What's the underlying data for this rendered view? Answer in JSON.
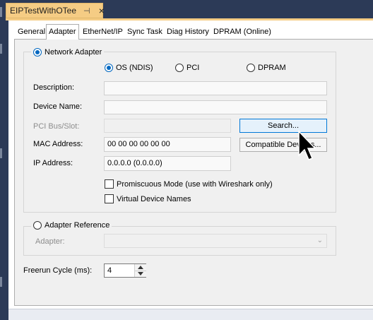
{
  "document_tab": {
    "title": "EIPTestWithOTee",
    "pin": "⊣",
    "close": "×"
  },
  "tabs": [
    "General",
    "Adapter",
    "EtherNet/IP",
    "Sync Task",
    "Diag History",
    "DPRAM (Online)"
  ],
  "active_tab": "Adapter",
  "network_adapter": {
    "radio_label": "Network Adapter",
    "selected": true,
    "mode_options": [
      "OS (NDIS)",
      "PCI",
      "DPRAM"
    ],
    "selected_mode": "OS (NDIS)",
    "description_label": "Description:",
    "description_value": "",
    "device_name_label": "Device Name:",
    "device_name_value": "",
    "pci_label": "PCI Bus/Slot:",
    "pci_value": "",
    "search_button": "Search...",
    "mac_label": "MAC Address:",
    "mac_value": "00 00 00 00 00 00",
    "compatible_button": "Compatible Devices...",
    "ip_label": "IP Address:",
    "ip_value": "0.0.0.0 (0.0.0.0)",
    "promiscuous_label": "Promiscuous Mode (use with Wireshark only)",
    "promiscuous_checked": false,
    "virtual_names_label": "Virtual Device Names",
    "virtual_names_checked": false
  },
  "adapter_reference": {
    "radio_label": "Adapter Reference",
    "selected": false,
    "adapter_label": "Adapter:",
    "adapter_value": ""
  },
  "freerun": {
    "label": "Freerun Cycle (ms):",
    "value": "4"
  },
  "colors": {
    "doc_tab": "#f5cc84",
    "accent": "#0067c0",
    "background": "#2c3a57"
  }
}
